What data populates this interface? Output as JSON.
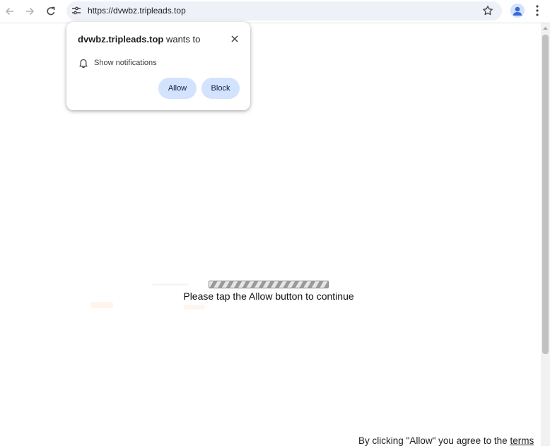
{
  "browser": {
    "url": "https://dvwbz.tripleads.top",
    "icons": {
      "back": "arrow-left-icon",
      "forward": "arrow-right-icon",
      "reload": "reload-icon",
      "site_info": "tune-icon",
      "bookmark": "star-icon",
      "profile": "person-icon",
      "menu": "kebab-icon"
    }
  },
  "popup": {
    "site": "dvwbz.tripleads.top",
    "title_suffix": " wants to",
    "permission": "Show notifications",
    "allow_label": "Allow",
    "block_label": "Block",
    "button_color": "#d3e3fd"
  },
  "page": {
    "message": "Please tap the Allow button to continue",
    "terms_prefix": "By clicking \"Allow\" you agree to the ",
    "terms_link": "terms"
  }
}
